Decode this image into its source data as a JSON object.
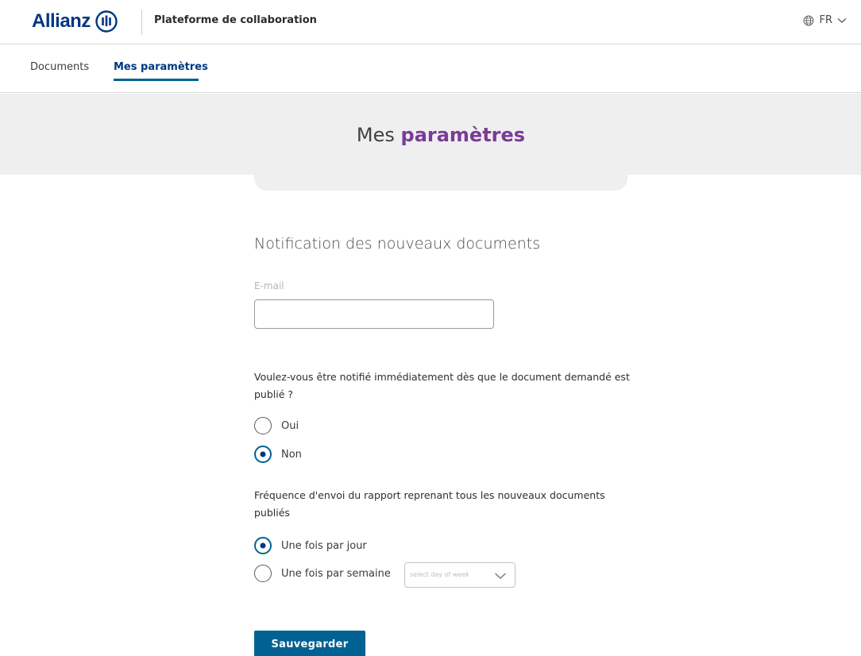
{
  "header": {
    "brand": "Allianz",
    "app_title": "Plateforme de collaboration",
    "language": "FR"
  },
  "tabs": [
    {
      "label": "Documents",
      "active": false
    },
    {
      "label": "Mes paramètres",
      "active": true
    }
  ],
  "banner": {
    "title_plain": "Mes ",
    "title_accent": "paramètres"
  },
  "form": {
    "section_title": "Notification des nouveaux documents",
    "email_label": "E-mail",
    "email_value": "",
    "question_immediate": "Voulez-vous être notifié immédiatement dès que le document demandé est publié ?",
    "immediate_options": [
      {
        "label": "Oui",
        "checked": false
      },
      {
        "label": "Non",
        "checked": true
      }
    ],
    "question_frequency": "Fréquence d'envoi du rapport reprenant tous les nouveaux documents publiés",
    "frequency_options": [
      {
        "label": "Une fois par jour",
        "checked": true
      },
      {
        "label": "Une fois par semaine",
        "checked": false
      }
    ],
    "day_select_placeholder": "select day of week",
    "save_label": "Sauvegarder"
  },
  "colors": {
    "brand_blue": "#003781",
    "button_blue": "#006192",
    "accent_purple": "#7a3b96",
    "banner_bg": "#efefef"
  },
  "icons": {
    "logo": "allianz-logo-icon",
    "language": "globe-icon",
    "dropdown": "chevron-down-icon"
  }
}
